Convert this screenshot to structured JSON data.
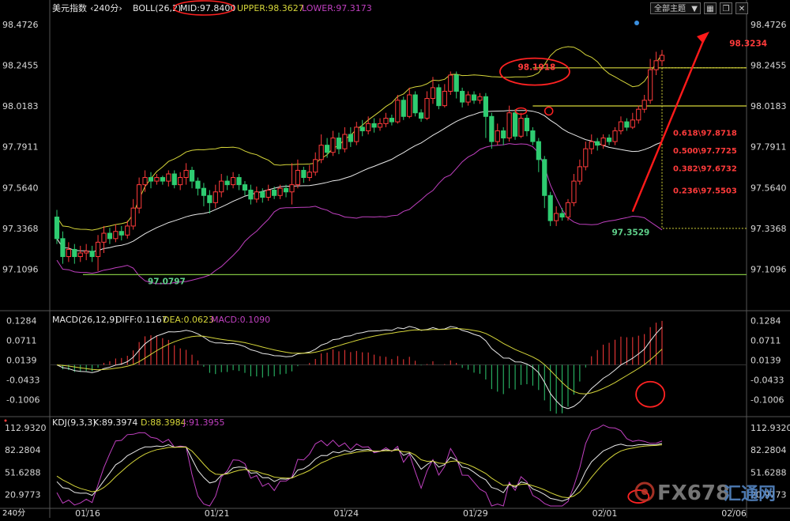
{
  "toolbar": {
    "theme_label": "全部主题",
    "icons": [
      "chevron-down-icon",
      "grid-icon",
      "restore-icon",
      "close-icon"
    ]
  },
  "watermark": {
    "brand": "FX678",
    "cn": "汇通网"
  },
  "colors": {
    "up": "#ff3b3b",
    "down": "#2ecc71",
    "mid": "#e8e8e8",
    "upper": "#d6d63a",
    "lower": "#c040c0",
    "support": "#7fbf3f",
    "arrow": "#ff1a1a",
    "annot": "#ff3b3b"
  },
  "chart_data": [
    {
      "type": "candlestick",
      "panel": "price",
      "indicator_title": "美元指数",
      "period": "240分",
      "boll_label": "BOLL(26,2)",
      "mid_label": "MID:97.8400",
      "upper_label": "UPPER:98.3627",
      "lower_label": "LOWER:97.3173",
      "ylim": [
        96.98,
        98.52
      ],
      "yticks": [
        98.4726,
        98.2455,
        98.0183,
        97.7911,
        97.564,
        97.3368,
        97.1096
      ],
      "xticks": [
        {
          "i": 5,
          "label": "01/16"
        },
        {
          "i": 27,
          "label": "01/21"
        },
        {
          "i": 49,
          "label": "01/24"
        },
        {
          "i": 71,
          "label": "01/29"
        },
        {
          "i": 93,
          "label": "02/01"
        },
        {
          "i": 115,
          "label": "02/06"
        }
      ],
      "hlines": [
        {
          "value": 97.0797,
          "color": "support"
        },
        {
          "value": 98.2305,
          "color": "upper",
          "x_from": 81
        },
        {
          "value": 98.0183,
          "color": "upper",
          "x_from": 81
        }
      ],
      "fib_levels": [
        {
          "label": "0.618\\97.8718",
          "y": 97.8718
        },
        {
          "label": "0.500\\97.7725",
          "y": 97.7725
        },
        {
          "label": "0.382\\97.6732",
          "y": 97.6732
        },
        {
          "label": "0.236\\97.5503",
          "y": 97.5503
        }
      ],
      "annotations": [
        {
          "label": "98.1918",
          "value": 98.1918,
          "i": 79
        },
        {
          "label": "97.3529",
          "value": 97.3529,
          "i": 95
        },
        {
          "label": "97.0797",
          "value": 97.0797,
          "i": 16
        },
        {
          "label": "98.3234",
          "value": 98.3234,
          "i": 115
        }
      ],
      "candles": [
        [
          97.4,
          97.28,
          97.44,
          97.25
        ],
        [
          97.28,
          97.18,
          97.32,
          97.14
        ],
        [
          97.18,
          97.22,
          97.26,
          97.15
        ],
        [
          97.22,
          97.18,
          97.25,
          97.14
        ],
        [
          97.18,
          97.2,
          97.24,
          97.15
        ],
        [
          97.2,
          97.21,
          97.25,
          97.16
        ],
        [
          97.21,
          97.18,
          97.24,
          97.15
        ],
        [
          97.18,
          97.26,
          97.3,
          97.1
        ],
        [
          97.26,
          97.31,
          97.35,
          97.2
        ],
        [
          97.31,
          97.28,
          97.34,
          97.25
        ],
        [
          97.28,
          97.32,
          97.36,
          97.26
        ],
        [
          97.32,
          97.3,
          97.35,
          97.27
        ],
        [
          97.3,
          97.35,
          97.38,
          97.28
        ],
        [
          97.35,
          97.45,
          97.5,
          97.33
        ],
        [
          97.45,
          97.58,
          97.62,
          97.42
        ],
        [
          97.58,
          97.62,
          97.66,
          97.54
        ],
        [
          97.62,
          97.6,
          97.65,
          97.56
        ],
        [
          97.6,
          97.62,
          97.64,
          97.58
        ],
        [
          97.62,
          97.6,
          97.63,
          97.58
        ],
        [
          97.6,
          97.64,
          97.66,
          97.57
        ],
        [
          97.64,
          97.58,
          97.66,
          97.56
        ],
        [
          97.58,
          97.62,
          97.65,
          97.55
        ],
        [
          97.62,
          97.66,
          97.7,
          97.58
        ],
        [
          97.66,
          97.6,
          97.68,
          97.56
        ],
        [
          97.6,
          97.56,
          97.62,
          97.52
        ],
        [
          97.56,
          97.52,
          97.59,
          97.46
        ],
        [
          97.52,
          97.48,
          97.55,
          97.42
        ],
        [
          97.48,
          97.54,
          97.58,
          97.45
        ],
        [
          97.54,
          97.6,
          97.64,
          97.51
        ],
        [
          97.6,
          97.58,
          97.63,
          97.55
        ],
        [
          97.58,
          97.62,
          97.65,
          97.56
        ],
        [
          97.62,
          97.58,
          97.64,
          97.55
        ],
        [
          97.58,
          97.55,
          97.6,
          97.52
        ],
        [
          97.55,
          97.5,
          97.58,
          97.47
        ],
        [
          97.5,
          97.54,
          97.57,
          97.48
        ],
        [
          97.54,
          97.51,
          97.56,
          97.48
        ],
        [
          97.51,
          97.55,
          97.58,
          97.49
        ],
        [
          97.55,
          97.52,
          97.57,
          97.5
        ],
        [
          97.52,
          97.56,
          97.58,
          97.5
        ],
        [
          97.56,
          97.54,
          97.58,
          97.51
        ],
        [
          97.54,
          97.58,
          97.7,
          97.47
        ],
        [
          97.58,
          97.66,
          97.72,
          97.56
        ],
        [
          97.66,
          97.62,
          97.68,
          97.59
        ],
        [
          97.62,
          97.65,
          97.69,
          97.6
        ],
        [
          97.65,
          97.72,
          97.76,
          97.63
        ],
        [
          97.72,
          97.8,
          97.86,
          97.7
        ],
        [
          97.8,
          97.76,
          97.84,
          97.73
        ],
        [
          97.76,
          97.84,
          97.88,
          97.74
        ],
        [
          97.84,
          97.78,
          97.87,
          97.75
        ],
        [
          97.78,
          97.86,
          97.9,
          97.76
        ],
        [
          97.86,
          97.82,
          97.9,
          97.79
        ],
        [
          97.82,
          97.9,
          97.93,
          97.8
        ],
        [
          97.9,
          97.88,
          97.94,
          97.85
        ],
        [
          97.88,
          97.92,
          97.96,
          97.86
        ],
        [
          97.92,
          97.9,
          97.95,
          97.87
        ],
        [
          97.9,
          97.92,
          97.95,
          97.88
        ],
        [
          97.92,
          97.95,
          97.98,
          97.9
        ],
        [
          97.95,
          97.93,
          97.97,
          97.91
        ],
        [
          97.93,
          98.05,
          98.08,
          97.92
        ],
        [
          98.05,
          97.96,
          98.07,
          97.94
        ],
        [
          97.96,
          98.08,
          98.12,
          97.95
        ],
        [
          98.08,
          97.98,
          98.1,
          97.96
        ],
        [
          97.98,
          97.95,
          98.0,
          97.93
        ],
        [
          97.95,
          98.06,
          98.1,
          97.94
        ],
        [
          98.06,
          98.12,
          98.18,
          98.03
        ],
        [
          98.12,
          98.02,
          98.14,
          98.0
        ],
        [
          98.02,
          98.1,
          98.14,
          98.01
        ],
        [
          98.1,
          98.19,
          98.21,
          98.08
        ],
        [
          98.19,
          98.1,
          98.21,
          98.06
        ],
        [
          98.1,
          98.04,
          98.12,
          98.01
        ],
        [
          98.04,
          98.08,
          98.1,
          98.02
        ],
        [
          98.08,
          98.05,
          98.1,
          98.03
        ],
        [
          98.05,
          98.07,
          98.09,
          98.03
        ],
        [
          98.07,
          97.96,
          98.09,
          97.84
        ],
        [
          97.96,
          97.82,
          97.98,
          97.78
        ],
        [
          97.82,
          97.88,
          97.92,
          97.8
        ],
        [
          97.88,
          97.84,
          97.9,
          97.8
        ],
        [
          97.84,
          97.98,
          98.02,
          97.82
        ],
        [
          97.98,
          97.85,
          98.0,
          97.83
        ],
        [
          97.85,
          97.95,
          97.98,
          97.84
        ],
        [
          97.95,
          97.88,
          97.97,
          97.85
        ],
        [
          97.88,
          97.82,
          97.9,
          97.8
        ],
        [
          97.82,
          97.72,
          97.84,
          97.65
        ],
        [
          97.72,
          97.52,
          97.74,
          97.45
        ],
        [
          97.52,
          97.38,
          97.54,
          97.35
        ],
        [
          97.38,
          97.42,
          97.46,
          97.35
        ],
        [
          97.42,
          97.4,
          97.45,
          97.38
        ],
        [
          97.4,
          97.48,
          97.5,
          97.38
        ],
        [
          97.48,
          97.6,
          97.64,
          97.46
        ],
        [
          97.6,
          97.68,
          97.72,
          97.58
        ],
        [
          97.68,
          97.78,
          97.82,
          97.66
        ],
        [
          97.78,
          97.82,
          97.86,
          97.75
        ],
        [
          97.82,
          97.8,
          97.84,
          97.77
        ],
        [
          97.8,
          97.84,
          97.86,
          97.78
        ],
        [
          97.84,
          97.82,
          97.86,
          97.8
        ],
        [
          97.82,
          97.88,
          97.9,
          97.8
        ],
        [
          97.88,
          97.93,
          97.96,
          97.86
        ],
        [
          97.93,
          97.9,
          97.95,
          97.88
        ],
        [
          97.9,
          97.94,
          97.98,
          97.89
        ],
        [
          97.94,
          98.0,
          98.02,
          97.92
        ],
        [
          98.0,
          98.05,
          98.08,
          97.98
        ],
        [
          98.05,
          98.22,
          98.28,
          98.03
        ],
        [
          98.22,
          98.27,
          98.32,
          98.19
        ],
        [
          98.27,
          98.3,
          98.33,
          98.24
        ]
      ]
    },
    {
      "type": "macd",
      "panel": "macd",
      "title": "MACD(26,12,9)",
      "diff_label": "DIFF:0.1167",
      "dea_label": "DEA:0.0623",
      "macd_label": "MACD:0.1090",
      "ylim": [
        -0.145,
        0.145
      ],
      "yticks": [
        0.1284,
        0.0711,
        0.0139,
        -0.0433,
        -0.1006
      ]
    },
    {
      "type": "kdj",
      "panel": "kdj",
      "title": "KDJ(9,3,3)",
      "k_label": "K:89.3974",
      "d_label": "D:88.3984",
      "j_label": "J:91.3955",
      "ylim": [
        5,
        125
      ],
      "yticks": [
        112.932,
        82.2804,
        51.6288,
        20.9773
      ],
      "corner_label": "240分"
    }
  ]
}
